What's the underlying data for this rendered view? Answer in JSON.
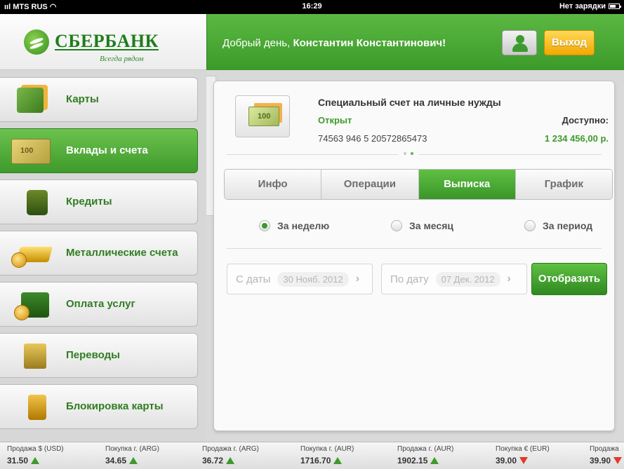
{
  "status_bar": {
    "carrier": "MTS RUS",
    "time": "16:29",
    "battery_text": "Нет зарядки"
  },
  "logo": {
    "name": "СБЕРБАНК",
    "tagline": "Всегда рядом"
  },
  "header": {
    "greeting_prefix": "Добрый день,",
    "user_name": "Константин Константинович!",
    "exit_label": "Выход"
  },
  "sidebar": {
    "items": [
      {
        "label": "Карты",
        "icon": "card-icon"
      },
      {
        "label": "Вклады и счета",
        "icon": "banknote-icon",
        "active": true
      },
      {
        "label": "Кредиты",
        "icon": "wallet-icon"
      },
      {
        "label": "Металлические счета",
        "icon": "gold-bar-icon"
      },
      {
        "label": "Оплата услуг",
        "icon": "briefcase-icon"
      },
      {
        "label": "Переводы",
        "icon": "transfer-icon"
      },
      {
        "label": "Блокировка карты",
        "icon": "lock-icon"
      }
    ]
  },
  "account": {
    "title": "Специальный счет на личные нужды",
    "status": "Открыт",
    "number": "74563 946 5 20572865473",
    "available_label": "Доступно:",
    "available_amount": "1 234 456,00 р."
  },
  "tabs": [
    {
      "label": "Инфо"
    },
    {
      "label": "Операции"
    },
    {
      "label": "Выписка",
      "active": true
    },
    {
      "label": "График"
    }
  ],
  "period_options": [
    {
      "label": "За неделю",
      "selected": true
    },
    {
      "label": "За месяц",
      "selected": false
    },
    {
      "label": "За период",
      "selected": false
    }
  ],
  "date_from": {
    "label": "С даты",
    "value": "30 Нояб. 2012"
  },
  "date_to": {
    "label": "По дату",
    "value": "07 Дек. 2012"
  },
  "show_button": "Отобразить",
  "ticker": [
    {
      "label": "Продажа $ (USD)",
      "value": "31.50",
      "trend": "up"
    },
    {
      "label": "Покупка г. (ARG)",
      "value": "34.65",
      "trend": "up"
    },
    {
      "label": "Продажа г. (ARG)",
      "value": "36.72",
      "trend": "up"
    },
    {
      "label": "Покупка г. (AUR)",
      "value": "1716.70",
      "trend": "up"
    },
    {
      "label": "Продажа г. (AUR)",
      "value": "1902.15",
      "trend": "up"
    },
    {
      "label": "Покупка € (EUR)",
      "value": "39.00",
      "trend": "down"
    },
    {
      "label": "Продажа",
      "value": "39.90",
      "trend": "down"
    }
  ],
  "colors": {
    "brand_green": "#3e9a2b",
    "accent_yellow": "#f2a800",
    "down_red": "#e03a2a"
  }
}
